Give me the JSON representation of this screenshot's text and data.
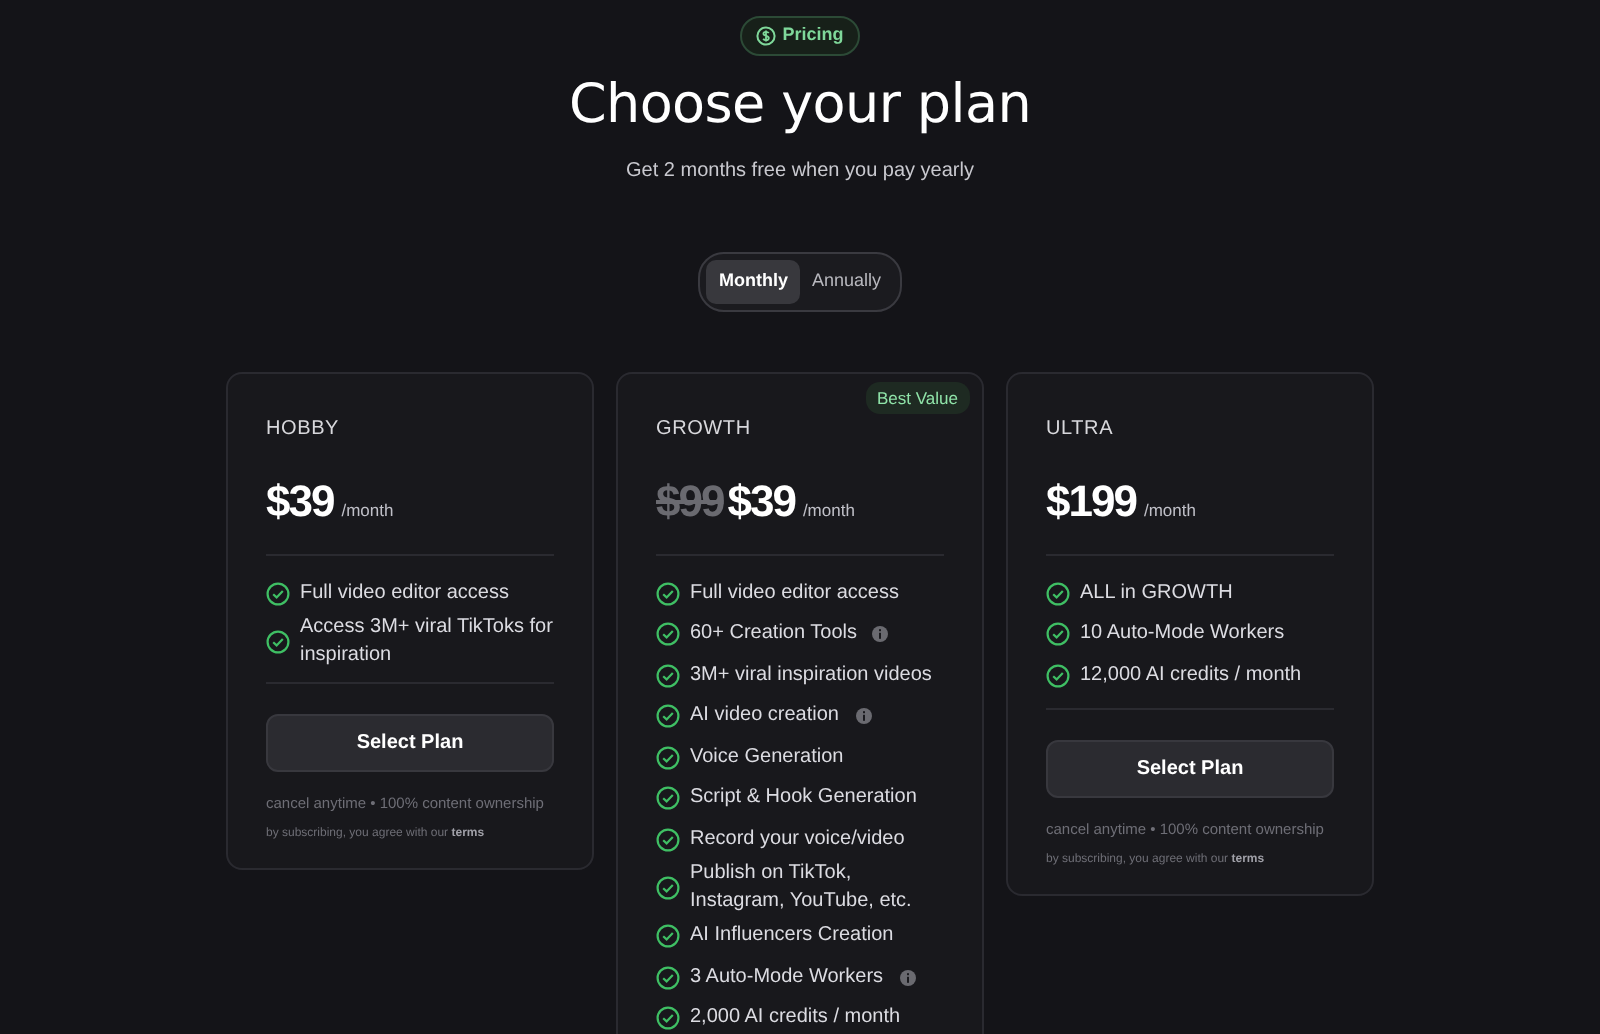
{
  "badge": {
    "label": "Pricing"
  },
  "title": "Choose your plan",
  "subtitle": "Get 2 months free when you pay yearly",
  "billing_toggle": [
    {
      "label": "Monthly",
      "selected": true
    },
    {
      "label": "Annually",
      "selected": false
    }
  ],
  "plans": [
    {
      "name": "HOBBY",
      "price": "$39",
      "period": "/month",
      "features": [
        {
          "text": "Full video editor access",
          "info": false
        },
        {
          "text": "Access 3M+ viral TikToks for inspiration",
          "info": false
        }
      ],
      "button": "Select Plan",
      "note": "cancel anytime • 100% content ownership",
      "legal": "by subscribing, you agree with our",
      "terms_link": "terms"
    },
    {
      "name": "GROWTH",
      "tag": "Best Value",
      "old_price": "$99",
      "price": "$39",
      "period": "/month",
      "features": [
        {
          "text": "Full video editor access",
          "info": false
        },
        {
          "text": "60+ Creation Tools",
          "info": true
        },
        {
          "text": "3M+ viral inspiration videos",
          "info": false
        },
        {
          "text": "AI video creation",
          "info": true
        },
        {
          "text": "Voice Generation",
          "info": false
        },
        {
          "text": "Script & Hook Generation",
          "info": false
        },
        {
          "text": "Record your voice/video",
          "info": false
        },
        {
          "text": "Publish on TikTok, Instagram, YouTube, etc.",
          "info": false
        },
        {
          "text": "AI Influencers Creation",
          "info": false
        },
        {
          "text": "3 Auto-Mode Workers",
          "info": true
        },
        {
          "text": "2,000 AI credits / month",
          "info": false
        }
      ]
    },
    {
      "name": "ULTRA",
      "price": "$199",
      "period": "/month",
      "features": [
        {
          "text": "ALL in GROWTH",
          "info": false
        },
        {
          "text": "10 Auto-Mode Workers",
          "info": false
        },
        {
          "text": "12,000 AI credits / month",
          "info": false
        }
      ],
      "button": "Select Plan",
      "note": "cancel anytime • 100% content ownership",
      "legal": "by subscribing, you agree with our",
      "terms_link": "terms"
    }
  ]
}
